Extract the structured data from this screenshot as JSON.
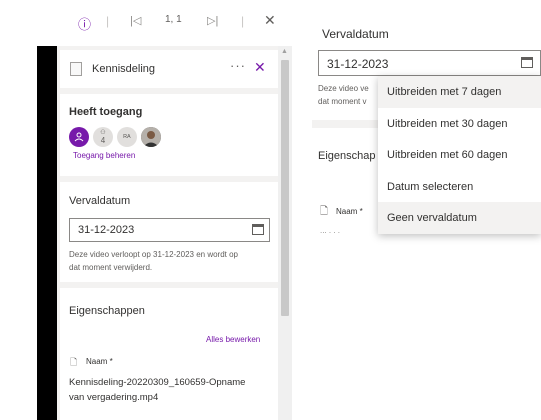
{
  "viewer": {
    "info_icon": "info-icon",
    "first_icon": "first-page-icon",
    "page_indicator": "1, 1",
    "last_icon": "last-page-icon",
    "close_icon": "close-icon"
  },
  "panel": {
    "title": "Kennisdeling",
    "more": "···",
    "close": "✕"
  },
  "access": {
    "title": "Heeft toegang",
    "avatars": [
      {
        "label": "A",
        "bg": "#7719aa",
        "fg": "#ffffff"
      },
      {
        "label": "4",
        "bg": "#e1dfdd",
        "fg": "#605e5c"
      },
      {
        "label": "A",
        "bg": "#e1dfdd",
        "fg": "#605e5c"
      },
      {
        "label": "",
        "bg": "#5c5c5c",
        "fg": "#ffffff"
      }
    ],
    "manage_link": "Toegang beheren"
  },
  "expiry": {
    "title": "Vervaldatum",
    "date": "31-12-2023",
    "note_line1": "Deze video verloopt op 31-12-2023 en wordt op",
    "note_line2": "dat moment verwijderd."
  },
  "properties": {
    "title": "Eigenschappen",
    "edit_all": "Alles bewerken",
    "name_label": "Naam *",
    "name_line1": "Kennisdeling-20220309_160659-Opname",
    "name_line2": "van vergadering.mp4"
  },
  "right": {
    "expiry_title": "Vervaldatum",
    "date": "31-12-2023",
    "note_line1": "Deze video ve",
    "note_line2": "dat moment v",
    "properties_title": "Eigenschap",
    "name_label": "Naam *",
    "partial": "... . . ."
  },
  "menu": {
    "items": [
      "Uitbreiden met 7 dagen",
      "Uitbreiden met 30 dagen",
      "Uitbreiden met 60 dagen",
      "Datum selecteren",
      "Geen vervaldatum"
    ]
  },
  "colors": {
    "accent": "#7719aa",
    "panel_bg": "#f3f2f1"
  }
}
